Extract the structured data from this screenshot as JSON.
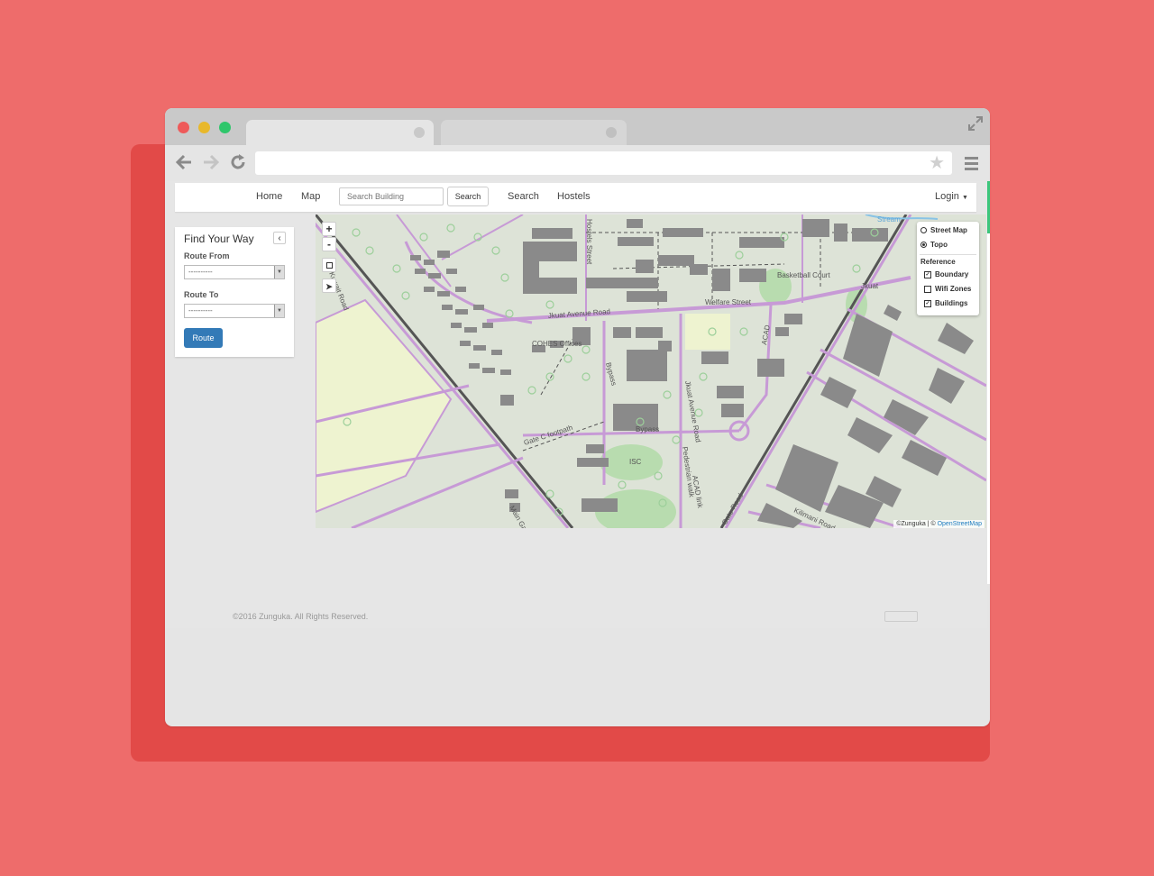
{
  "window": {
    "controls": [
      "close",
      "minimize",
      "maximize"
    ],
    "tabs": [
      "",
      ""
    ],
    "address": "",
    "icons": {
      "back": "arrow-left-icon",
      "forward": "arrow-right-icon",
      "reload": "reload-icon",
      "bookmark": "star-icon",
      "menu": "menu-icon",
      "expand": "expand-icon"
    }
  },
  "navbar": {
    "home": "Home",
    "map": "Map",
    "search_placeholder": "Search Building",
    "search_button": "Search",
    "search_link": "Search",
    "hostels": "Hostels",
    "login": "Login"
  },
  "sidebar": {
    "title": "Find Your Way",
    "route_from_label": "Route From",
    "route_from_value": "----------",
    "route_to_label": "Route To",
    "route_to_value": "----------",
    "route_button": "Route"
  },
  "map": {
    "zoom_in": "+",
    "zoom_out": "-",
    "labels": {
      "road_upper_left": "Kuwait Road",
      "jkuat_avenue": "Jkuat Avenue Road",
      "welfare_street": "Welfare Street",
      "cohes": "COHES Offices",
      "bypass1": "Bypass",
      "bypass2": "Bypass",
      "gate_footpath": "Gate C footpath",
      "basketball": "Basketball Court",
      "jkuat_ave_road_vertical": "Jkuat Avenue Road",
      "acad": "ACAD",
      "acad_link": "ACAD link",
      "pedestrian": "Pedestrian walk",
      "hostel_street": "Hostels Street",
      "jkuat_short": "Jkuat",
      "stream": "Stream",
      "isc": "ISC",
      "main_gate": "Main Gate Road",
      "lower_right_road": "Kilimani Road",
      "lower_left_road": "Gate Road"
    },
    "attribution": "©Zunguka",
    "attribution_link": "OpenStreetMap",
    "layers": {
      "base": [
        {
          "label": "Street Map",
          "selected": false
        },
        {
          "label": "Topo",
          "selected": true
        }
      ],
      "reference_title": "Reference",
      "overlays": [
        {
          "label": "Boundary",
          "checked": true
        },
        {
          "label": "Wifi Zones",
          "checked": false
        },
        {
          "label": "Buildings",
          "checked": true
        }
      ]
    },
    "colors": {
      "road": "#c79ad6",
      "green": "#b8dcaf",
      "building": "#8a8a8a",
      "field": "#eef3d0"
    }
  },
  "footer": {
    "copyright": "©2016 Zunguka. All Rights Reserved."
  },
  "colors": {
    "background": "#ee6c6b",
    "accent": "#337ab7",
    "scroll_accent": "#3cc67c"
  }
}
